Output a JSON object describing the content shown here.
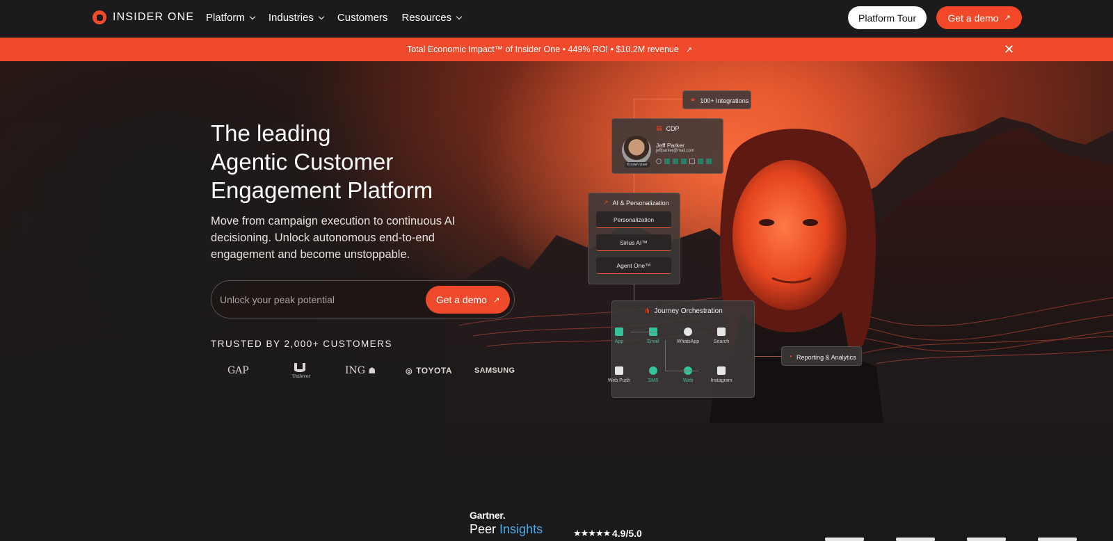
{
  "nav": {
    "logo_text": "INSIDER ONE",
    "menu": [
      {
        "label": "Platform",
        "has_dropdown": true
      },
      {
        "label": "Industries",
        "has_dropdown": true
      },
      {
        "label": "Customers",
        "has_dropdown": false
      },
      {
        "label": "Resources",
        "has_dropdown": true
      }
    ],
    "tour_label": "Platform Tour",
    "demo_label": "Get a demo"
  },
  "banner": {
    "text": "Total Economic Impact™ of Insider One • 449% ROI • $10.2M revenue",
    "close_symbol": "✕"
  },
  "hero": {
    "headline": [
      "The leading",
      "Agentic Customer",
      "Engagement Platform"
    ],
    "subtitle": "Move from campaign execution to continuous AI decisioning. Unlock autonomous end-to-end engagement and become unstoppable.",
    "email_placeholder": "Unlock your peak potential",
    "cta_label": "Get a demo",
    "trusted_label": "TRUSTED BY 2,000+ CUSTOMERS",
    "customer_logos": [
      "GAP",
      "Unilever",
      "ING",
      "TOYOTA",
      "SAMSUNG"
    ]
  },
  "diagram": {
    "integrations": "100+ Integrations",
    "cdp": {
      "title": "CDP",
      "name": "Jeff Parker",
      "email": "jeffparker@mail.com",
      "badge": "Known User"
    },
    "ai": {
      "title": "AI & Personalization",
      "items": [
        "Personalization",
        "Sirius AI™",
        "Agent One™"
      ]
    },
    "journey": {
      "title": "Journey Orchestration",
      "row1": [
        {
          "label": "App",
          "active": true
        },
        {
          "label": "Email",
          "active": true
        },
        {
          "label": "WhatsApp",
          "active": false
        },
        {
          "label": "Search",
          "active": false
        }
      ],
      "row2": [
        {
          "label": "Web Push",
          "active": false
        },
        {
          "label": "SMS",
          "active": true
        },
        {
          "label": "Web",
          "active": true
        },
        {
          "label": "Instagram",
          "active": false
        }
      ]
    },
    "reporting": "Reporting & Analytics"
  },
  "gartner": {
    "brand": "Gartner.",
    "peer": "Peer",
    "insights": "Insights",
    "stars": "★★★★★",
    "rating": "4.9/5.0"
  },
  "colors": {
    "accent": "#ef4a2b",
    "bg": "#1a1a1c",
    "active_node": "#35c49a"
  }
}
